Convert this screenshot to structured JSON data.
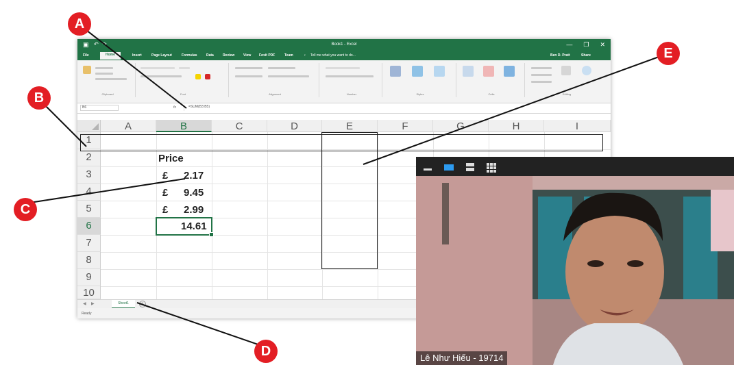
{
  "excel": {
    "title": "Book1 - Excel",
    "window_controls": [
      "—",
      "❐",
      "✕"
    ],
    "ribbon_tabs": [
      "File",
      "Home",
      "Insert",
      "Page Layout",
      "Formulas",
      "Data",
      "Review",
      "View",
      "Foxit PDF",
      "Team"
    ],
    "tell_me": "Tell me what you want to do...",
    "user": "Ben D. Pratt",
    "share": "Share",
    "group_labels": [
      "Clipboard",
      "Font",
      "Alignment",
      "Number",
      "Styles",
      "Cells",
      "Editing"
    ],
    "formula_bar": {
      "name_box": "B6",
      "fx": "fx",
      "formula": "=SUM(B3:B5)"
    },
    "columns": [
      "A",
      "B",
      "C",
      "D",
      "E",
      "F",
      "G",
      "H",
      "I"
    ],
    "selected_column": "B",
    "rows": [
      "1",
      "2",
      "3",
      "4",
      "5",
      "6",
      "7",
      "8",
      "9",
      "10"
    ],
    "selected_row": "6",
    "cells": {
      "b2": "Price",
      "b3_currency": "£",
      "b3_value": "2.17",
      "b4_currency": "£",
      "b4_value": "9.45",
      "b5_currency": "£",
      "b5_value": "2.99",
      "b6_value": "14.61"
    },
    "sheet_tab": "Sheet1",
    "status": "Ready"
  },
  "callouts": {
    "a": "A",
    "b": "B",
    "c": "C",
    "d": "D",
    "e": "E"
  },
  "video": {
    "participant_name": "Lê Như Hiếu - 19714"
  },
  "colors": {
    "excel_green": "#217346",
    "callout_red": "#e31e24"
  }
}
